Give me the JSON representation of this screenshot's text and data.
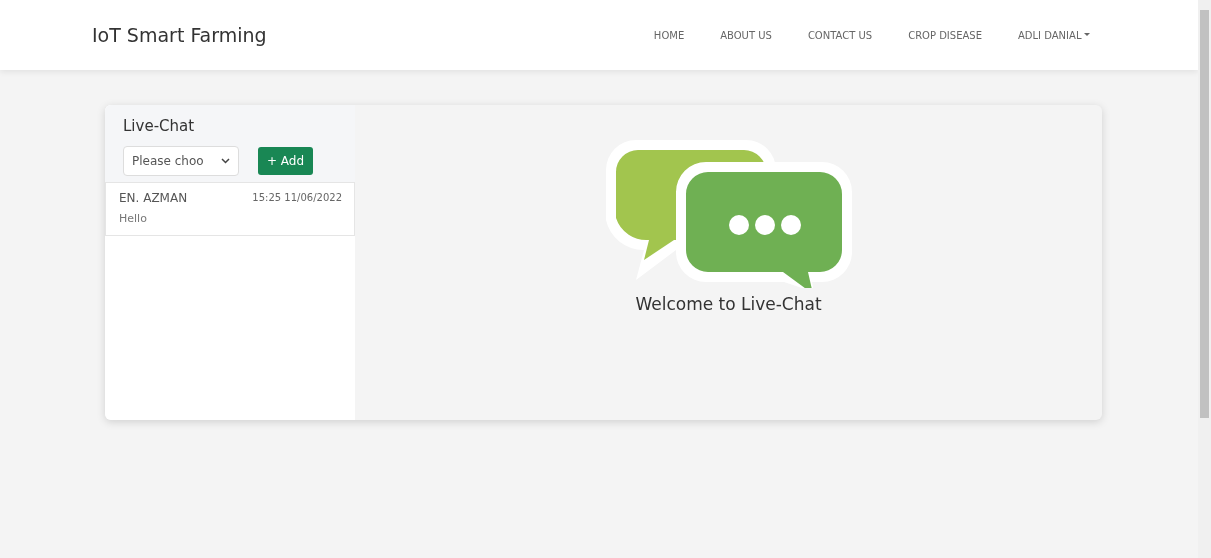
{
  "navbar": {
    "brand": "IoT Smart Farming",
    "links": [
      {
        "label": "HOME",
        "dropdown": false
      },
      {
        "label": "ABOUT US",
        "dropdown": false
      },
      {
        "label": "CONTACT US",
        "dropdown": false
      },
      {
        "label": "CROP DISEASE",
        "dropdown": false
      },
      {
        "label": "ADLI DANIAL",
        "dropdown": true
      }
    ]
  },
  "sidebar": {
    "title": "Live-Chat",
    "select": {
      "value": "Please choo"
    },
    "add_button": "+ Add",
    "chats": [
      {
        "name": "EN. AZMAN",
        "time": "15:25 11/06/2022",
        "message": "Hello"
      }
    ]
  },
  "main": {
    "welcome": "Welcome to Live-Chat"
  }
}
